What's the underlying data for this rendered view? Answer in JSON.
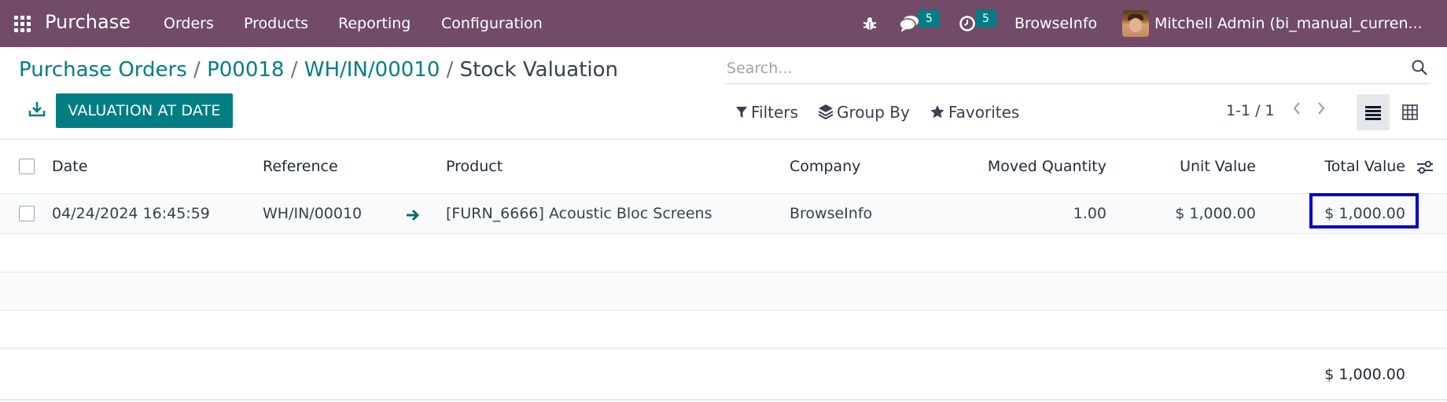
{
  "colors": {
    "navbar": "#714b67",
    "primary": "#017e84",
    "highlight_border": "#0000cc"
  },
  "navbar": {
    "app_name": "Purchase",
    "menus": [
      "Orders",
      "Products",
      "Reporting",
      "Configuration"
    ],
    "messages_count": "5",
    "activities_count": "5",
    "company": "BrowseInfo",
    "user": "Mitchell Admin (bi_manual_curren..."
  },
  "breadcrumb": {
    "items": [
      "Purchase Orders",
      "P00018",
      "WH/IN/00010"
    ],
    "current": "Stock Valuation",
    "separator": "/"
  },
  "search": {
    "placeholder": "Search...",
    "value": ""
  },
  "toolbar": {
    "valuation_button": "VALUATION AT DATE",
    "filters": "Filters",
    "group_by": "Group By",
    "favorites": "Favorites",
    "pager": "1-1 / 1"
  },
  "table": {
    "columns": [
      "Date",
      "Reference",
      "Product",
      "Company",
      "Moved Quantity",
      "Unit Value",
      "Total Value"
    ],
    "rows": [
      {
        "date": "04/24/2024 16:45:59",
        "reference": "WH/IN/00010",
        "product": "[FURN_6666] Acoustic Bloc Screens",
        "company": "BrowseInfo",
        "moved_quantity": "1.00",
        "unit_value": "$ 1,000.00",
        "total_value": "$ 1,000.00"
      }
    ],
    "footer_total": "$ 1,000.00"
  },
  "icons": {
    "apps": "apps-grid-icon",
    "debug": "bug-icon",
    "messages": "chat-icon",
    "activities": "clock-icon",
    "search": "search-icon",
    "download": "download-icon",
    "filter": "filter-icon",
    "group_by": "layers-icon",
    "favorites": "star-icon",
    "list_view": "list-view-icon",
    "pivot_view": "pivot-view-icon",
    "optional_columns": "sliders-icon",
    "row_link": "arrow-right-icon"
  }
}
